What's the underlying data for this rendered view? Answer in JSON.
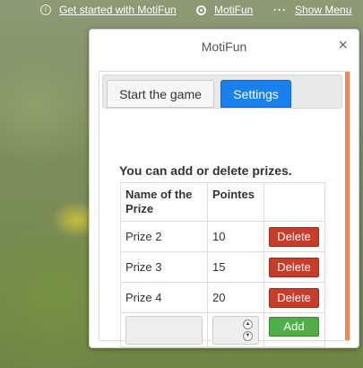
{
  "topbar": {
    "get_started": "Get started with MotiFun",
    "brand": "MotiFun",
    "show_menu": "Show Menu"
  },
  "dialog": {
    "title": "MotiFun",
    "close": "×",
    "tabs": [
      {
        "label": "Start the game",
        "active": false
      },
      {
        "label": "Settings",
        "active": true
      }
    ],
    "intro": "You can add or delete prizes.",
    "table": {
      "headers": [
        "Name of the Prize",
        "Pointes",
        ""
      ],
      "rows": [
        {
          "name": "Prize 2",
          "points": "10",
          "action": "Delete"
        },
        {
          "name": "Prize 3",
          "points": "15",
          "action": "Delete"
        },
        {
          "name": "Prize 4",
          "points": "20",
          "action": "Delete"
        }
      ],
      "new_row": {
        "name_value": "",
        "points_value": "",
        "add_label": "Add"
      }
    }
  },
  "icons": {
    "info": "info-icon",
    "logo": "motifun-logo-icon",
    "menu": "dots-menu-icon",
    "close": "close-icon",
    "spin_up": "chevron-up-icon",
    "spin_down": "chevron-down-icon"
  },
  "colors": {
    "tab_active": "#1a80ee",
    "delete": "#c83c2c",
    "add": "#4fae46",
    "scrollbar": "#f2885a"
  }
}
